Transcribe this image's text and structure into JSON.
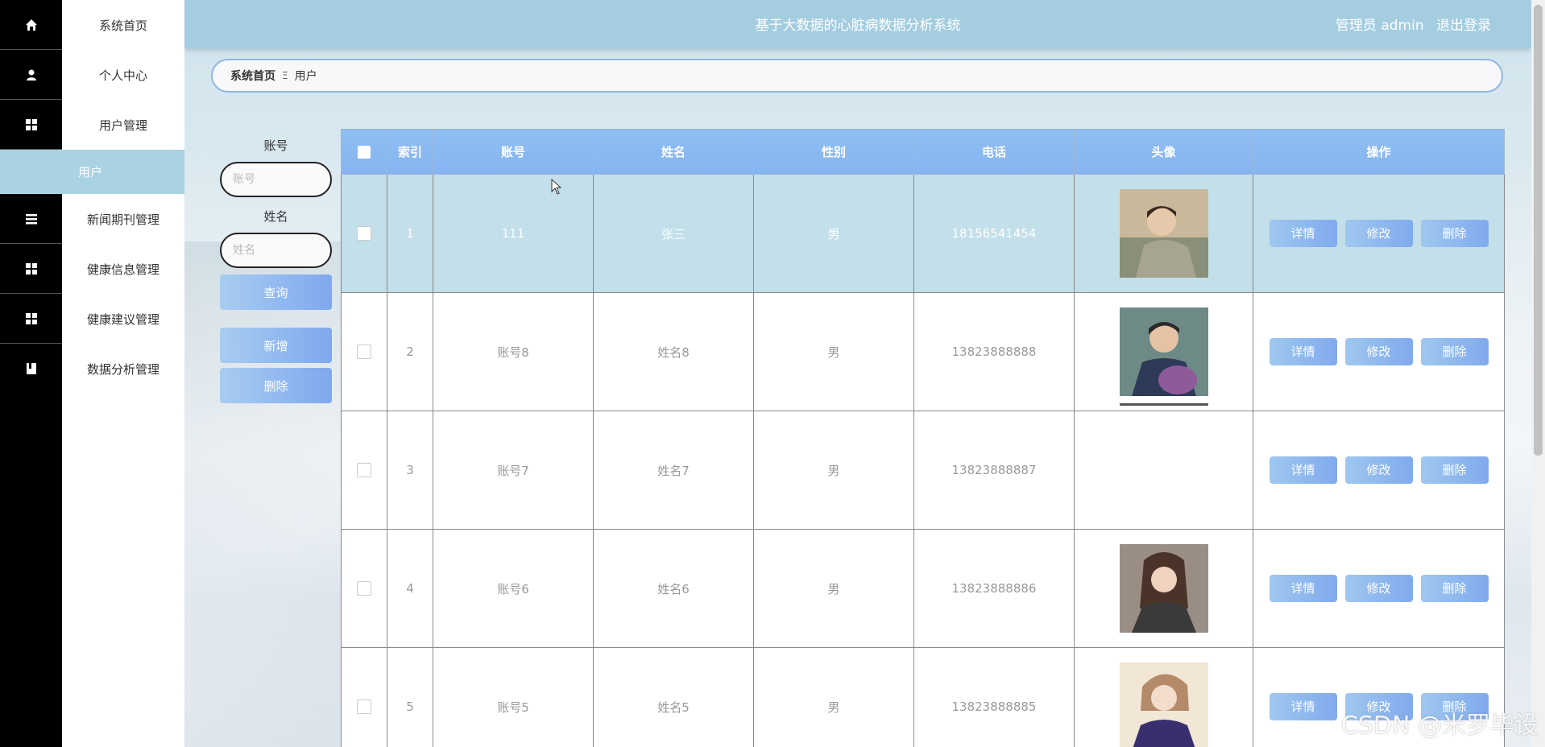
{
  "header": {
    "title": "基于大数据的心脏病数据分析系统",
    "user_label": "管理员 admin",
    "logout": "退出登录"
  },
  "sidebar": {
    "items": [
      {
        "label": "系统首页",
        "icon": "home-icon"
      },
      {
        "label": "个人中心",
        "icon": "person-icon"
      },
      {
        "label": "用户管理",
        "icon": "grid-icon"
      },
      {
        "label": "新闻期刊管理",
        "icon": "list-icon"
      },
      {
        "label": "健康信息管理",
        "icon": "grid-icon"
      },
      {
        "label": "健康建议管理",
        "icon": "grid-icon"
      },
      {
        "label": "数据分析管理",
        "icon": "book-icon"
      }
    ],
    "active_sub": "用户"
  },
  "breadcrumb": {
    "home": "系统首页",
    "separator": "Ξ",
    "current": "用户"
  },
  "search": {
    "account_label": "账号",
    "account_placeholder": "账号",
    "name_label": "姓名",
    "name_placeholder": "姓名",
    "query": "查询",
    "add": "新增",
    "delete": "删除"
  },
  "table": {
    "headers": [
      "索引",
      "账号",
      "姓名",
      "性别",
      "电话",
      "头像",
      "操作"
    ],
    "rows": [
      {
        "index": "1",
        "account": "111",
        "name": "张三",
        "gender": "男",
        "phone": "18156541454"
      },
      {
        "index": "2",
        "account": "账号8",
        "name": "姓名8",
        "gender": "男",
        "phone": "13823888888"
      },
      {
        "index": "3",
        "account": "账号7",
        "name": "姓名7",
        "gender": "男",
        "phone": "13823888887"
      },
      {
        "index": "4",
        "account": "账号6",
        "name": "姓名6",
        "gender": "男",
        "phone": "13823888886"
      },
      {
        "index": "5",
        "account": "账号5",
        "name": "姓名5",
        "gender": "男",
        "phone": "13823888885"
      }
    ],
    "actions": {
      "detail": "详情",
      "edit": "修改",
      "delete": "删除"
    }
  },
  "watermark": "CSDN @米罗毕设",
  "colors": {
    "topbar": "#a4cde0",
    "accent": "#86b4f0",
    "selected_row": "#c2dfea"
  }
}
